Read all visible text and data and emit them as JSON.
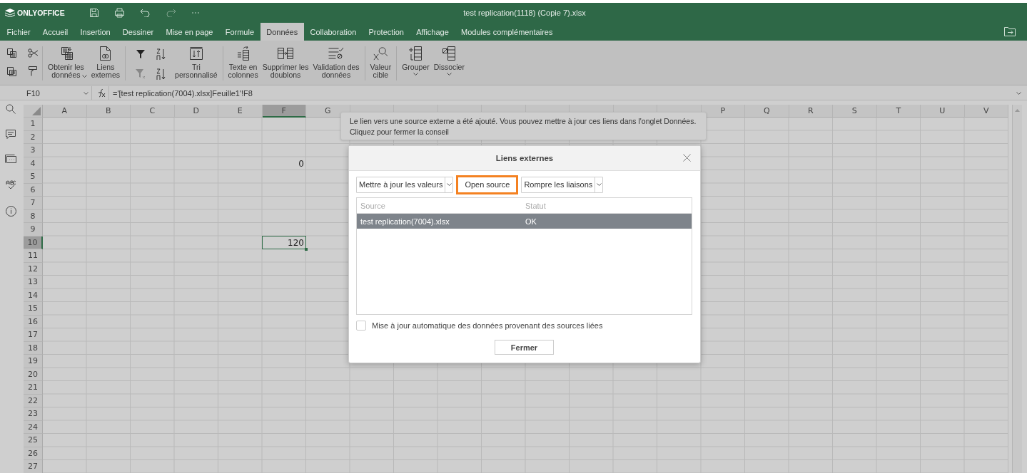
{
  "app": {
    "logo": "ONLYOFFICE",
    "title": "test replication(1118) (Copie 7).xlsx"
  },
  "menu_tabs": [
    {
      "label": "Fichier",
      "selected": false
    },
    {
      "label": "Accueil",
      "selected": false
    },
    {
      "label": "Insertion",
      "selected": false
    },
    {
      "label": "Dessiner",
      "selected": false
    },
    {
      "label": "Mise en page",
      "selected": false
    },
    {
      "label": "Formule",
      "selected": false
    },
    {
      "label": "Données",
      "selected": true
    },
    {
      "label": "Collaboration",
      "selected": false
    },
    {
      "label": "Protection",
      "selected": false
    },
    {
      "label": "Affichage",
      "selected": false
    },
    {
      "label": "Modules complémentaires",
      "selected": false
    }
  ],
  "toolbar": [
    {
      "lines": [
        "Obtenir les",
        "données"
      ],
      "has_caret": true
    },
    {
      "lines": [
        "Liens",
        "externes"
      ],
      "has_caret": false
    },
    {
      "lines": [
        "Tri",
        "personnalisé"
      ],
      "has_caret": false
    },
    {
      "lines": [
        "Texte en",
        "colonnes"
      ],
      "has_caret": false
    },
    {
      "lines": [
        "Supprimer les",
        "doublons"
      ],
      "has_caret": false
    },
    {
      "lines": [
        "Validation des",
        "données"
      ],
      "has_caret": false
    },
    {
      "lines": [
        "Valeur",
        "cible"
      ],
      "has_caret": false
    },
    {
      "lines": [
        "Grouper"
      ],
      "has_caret": true
    },
    {
      "lines": [
        "Dissocier"
      ],
      "has_caret": true
    }
  ],
  "formula_bar": {
    "cell_ref": "F10",
    "formula": "='[test replication(7004).xlsx]Feuille1'!F8"
  },
  "grid": {
    "columns": [
      {
        "label": "A",
        "selected": false
      },
      {
        "label": "B",
        "selected": false
      },
      {
        "label": "C",
        "selected": false
      },
      {
        "label": "D",
        "selected": false
      },
      {
        "label": "E",
        "selected": false
      },
      {
        "label": "F",
        "selected": true
      },
      {
        "label": "G",
        "selected": false
      },
      {
        "selected": false
      },
      {
        "selected": false
      },
      {
        "selected": false
      },
      {
        "selected": false
      },
      {
        "selected": false
      },
      {
        "selected": false
      },
      {
        "selected": false
      },
      {
        "selected": false
      },
      {
        "label": "P",
        "selected": false
      },
      {
        "label": "Q",
        "selected": false
      },
      {
        "label": "R",
        "selected": false
      },
      {
        "label": "S",
        "selected": false
      },
      {
        "label": "T",
        "selected": false
      },
      {
        "label": "U",
        "selected": false
      },
      {
        "label": "V",
        "selected": false
      }
    ],
    "rows": [
      {
        "label": "1",
        "selected": false
      },
      {
        "label": "2",
        "selected": false
      },
      {
        "label": "3",
        "selected": false
      },
      {
        "label": "4",
        "selected": false,
        "column_f": "0"
      },
      {
        "label": "5",
        "selected": false
      },
      {
        "label": "6",
        "selected": false
      },
      {
        "label": "7",
        "selected": false
      },
      {
        "label": "8",
        "selected": false
      },
      {
        "label": "9",
        "selected": false
      },
      {
        "label": "10",
        "selected": true,
        "column_f": "120"
      },
      {
        "label": "11",
        "selected": false
      },
      {
        "label": "12",
        "selected": false
      },
      {
        "label": "13",
        "selected": false
      },
      {
        "label": "14",
        "selected": false
      },
      {
        "label": "15",
        "selected": false
      },
      {
        "label": "16",
        "selected": false
      },
      {
        "label": "17",
        "selected": false
      },
      {
        "label": "18",
        "selected": false
      },
      {
        "label": "19",
        "selected": false
      },
      {
        "label": "20",
        "selected": false
      },
      {
        "label": "21",
        "selected": false
      },
      {
        "label": "22",
        "selected": false
      },
      {
        "label": "23",
        "selected": false
      },
      {
        "label": "24",
        "selected": false
      },
      {
        "label": "25",
        "selected": false
      },
      {
        "label": "26",
        "selected": false
      },
      {
        "label": "27",
        "selected": false
      }
    ]
  },
  "tooltip": {
    "lines": [
      "Le lien vers une source externe a été ajouté. Vous pouvez mettre à jour ces liens dans l'onglet Données.",
      "Cliquez pour fermer la conseil"
    ]
  },
  "dialog": {
    "title": "Liens externes",
    "update_button": "Mettre à jour les valeurs",
    "open_button": {
      "label": "Open source",
      "highlighted": true
    },
    "break_button": "Rompre les liaisons",
    "columns": [
      "Source",
      "Statut"
    ],
    "rows": [
      {
        "source": "test replication(7004).xlsx",
        "status": "OK",
        "selected": true
      }
    ],
    "auto_update": {
      "label": "Mise à jour automatique des données provenant des sources liées",
      "checked": false
    },
    "close_button": "Fermer"
  }
}
